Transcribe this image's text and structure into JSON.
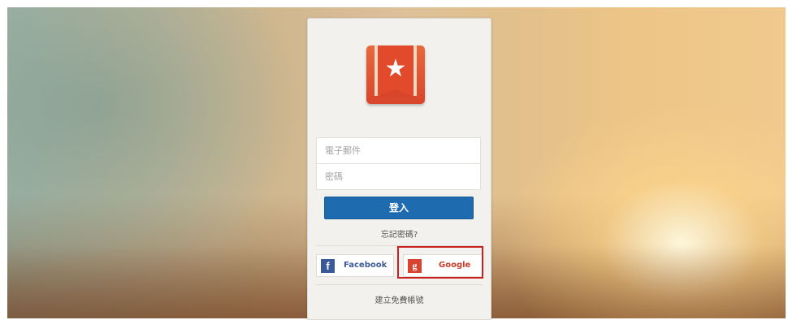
{
  "login": {
    "email_placeholder": "電子郵件",
    "password_placeholder": "密碼",
    "sign_in_label": "登入",
    "forgot_password": "忘記密碼?",
    "social": {
      "facebook_icon": "f",
      "facebook_label": "Facebook",
      "google_icon": "g",
      "google_label": "Google"
    },
    "create_account": "建立免費帳號"
  },
  "colors": {
    "brand_red": "#d9452a",
    "sign_in_blue": "#1e6bb0",
    "facebook_blue": "#3b5998",
    "google_red": "#d8442f",
    "highlight_outline": "#cc1f1f"
  },
  "icons": {
    "app_logo": "wunderlist-star-ribbon-icon",
    "facebook": "facebook-icon",
    "google": "google-icon"
  }
}
